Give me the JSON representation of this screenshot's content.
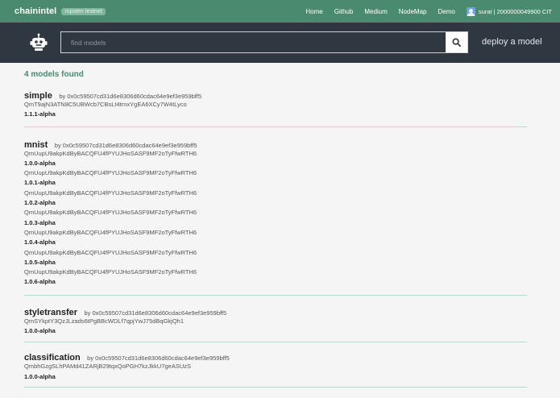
{
  "header": {
    "brand": "chainintel",
    "network": "ropsten testnet",
    "nav": [
      "Home",
      "Github",
      "Medium",
      "NodeMap",
      "Demo"
    ],
    "account": "surat | 2000000049900 CIT"
  },
  "search": {
    "placeholder": "find models",
    "deploy_label": "deploy a model"
  },
  "results": {
    "count_label": "4 models found",
    "models": [
      {
        "name": "simple",
        "by": "by 0x0c59507cd31d6e8306d60cdac64e9ef3e959bff5",
        "versions": [
          {
            "hash": "QmT9ajN3ATN8C5UBWcb7CBsLt4trnxYgEA6XCy7W4tLyco",
            "version": "1.1.1-alpha"
          }
        ]
      },
      {
        "name": "mnist",
        "by": "by 0x0c59507cd31d6e8306d60cdac64e9ef3e959bff5",
        "versions": [
          {
            "hash": "QmUupU9akpKdByBACQFU4fPYUJHoSASF9MF2oTyFfwRTH6",
            "version": "1.0.0-alpha"
          },
          {
            "hash": "QmUupU9akpKdByBACQFU4fPYUJHoSASF9MF2oTyFfwRTH6",
            "version": "1.0.1-alpha"
          },
          {
            "hash": "QmUupU9akpKdByBACQFU4fPYUJHoSASF9MF2oTyFfwRTH6",
            "version": "1.0.2-alpha"
          },
          {
            "hash": "QmUupU9akpKdByBACQFU4fPYUJHoSASF9MF2oTyFfwRTH6",
            "version": "1.0.3-alpha"
          },
          {
            "hash": "QmUupU9akpKdByBACQFU4fPYUJHoSASF9MF2oTyFfwRTH6",
            "version": "1.0.4-alpha"
          },
          {
            "hash": "QmUupU9akpKdByBACQFU4fPYUJHoSASF9MF2oTyFfwRTH6",
            "version": "1.0.5-alpha"
          },
          {
            "hash": "QmUupU9akpKdByBACQFU4fPYUJHoSASF9MF2oTyFfwRTH6",
            "version": "1.0.6-alpha"
          }
        ]
      },
      {
        "name": "styletransfer",
        "by": "by 0x0c59507cd31d6e8306d60cdac64e9ef3e959bff5",
        "versions": [
          {
            "hash": "QmSYkptY3QzJLzads6tPgBBcWDLf7qpjYwJ75dBqGkjQh1",
            "version": "1.0.0-alpha"
          }
        ]
      },
      {
        "name": "classification",
        "by": "by 0x0c59507cd31d6e8306d60cdac64e9ef3e959bff5",
        "versions": [
          {
            "hash": "QmbhGzgSLhPAMd41ZARjB29tqxQoPGH7kzJkkU7geASUzS",
            "version": "1.0.0-alpha"
          }
        ]
      }
    ]
  },
  "colors": {
    "topbar": "#4a8a6f",
    "searchbar": "#2f3840",
    "accent": "#4a8a6f",
    "divider": "#b8ddd0"
  },
  "icons": {
    "logo": "robot-icon",
    "search": "search-icon",
    "avatar": "avatar-icon"
  }
}
